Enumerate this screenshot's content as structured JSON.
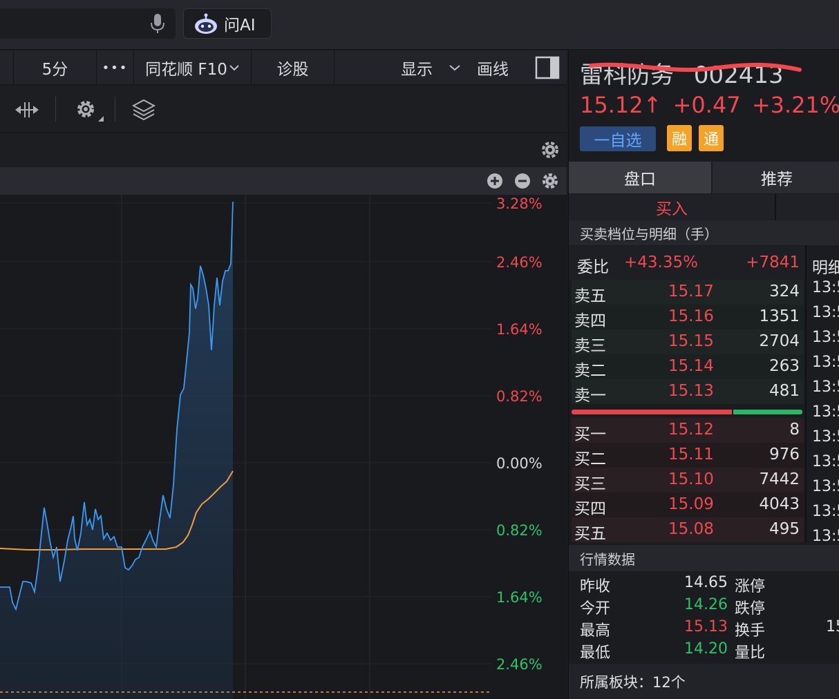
{
  "topbar": {
    "ai_label": "问AI"
  },
  "toolbar": {
    "period": "5分",
    "more": "•••",
    "f10": "同花顺 F10",
    "diagnose": "诊股",
    "display": "显示",
    "draw": "画线"
  },
  "chart": {
    "right_axis": [
      "3.28%",
      "2.46%",
      "1.64%",
      "0.82%",
      "0.00%",
      "0.82%",
      "1.64%",
      "2.46%"
    ],
    "right_axis_colors": [
      "#f0494f",
      "#f0494f",
      "#f0494f",
      "#f0494f",
      "#d6d7da",
      "#2cc26a",
      "#2cc26a",
      "#2cc26a"
    ],
    "price_line_color": "#3a9bf5",
    "avg_line_color": "#f29c38"
  },
  "stock": {
    "name": "雷科防务",
    "code": "002413",
    "price": "15.12↑",
    "change": "+0.47",
    "change_pct": "+3.21%",
    "fav_label": "一自选",
    "badge_margin": "融",
    "badge_connect": "通"
  },
  "tabs": {
    "tab1": "盘口",
    "tab2": "推荐"
  },
  "subtabs": {
    "buy": "买入"
  },
  "orderbook": {
    "title": "买卖档位与明细（手）",
    "ratio_label": "委比",
    "ratio_pct": "+43.35%",
    "ratio_diff": "+7841",
    "sell": [
      {
        "label": "卖五",
        "price": "15.17",
        "vol": "324"
      },
      {
        "label": "卖四",
        "price": "15.16",
        "vol": "1351"
      },
      {
        "label": "卖三",
        "price": "15.15",
        "vol": "2704"
      },
      {
        "label": "卖二",
        "price": "15.14",
        "vol": "263"
      },
      {
        "label": "卖一",
        "price": "15.13",
        "vol": "481"
      }
    ],
    "buy": [
      {
        "label": "买一",
        "price": "15.12",
        "vol": "8"
      },
      {
        "label": "买二",
        "price": "15.11",
        "vol": "976"
      },
      {
        "label": "买三",
        "price": "15.10",
        "vol": "7442"
      },
      {
        "label": "买四",
        "price": "15.09",
        "vol": "4043"
      },
      {
        "label": "买五",
        "price": "15.08",
        "vol": "495"
      }
    ],
    "buy_share": 0.7
  },
  "detail": {
    "header": "明细",
    "times": [
      "13:5",
      "13:5",
      "13:5",
      "13:5",
      "13:5",
      "13:5",
      "13:5",
      "13:5",
      "13:5",
      "13:5",
      "13:5"
    ]
  },
  "quote": {
    "title": "行情数据",
    "rows": [
      {
        "k": "昨收",
        "v": "14.65",
        "vc": "#e0e1e4",
        "k2": "涨停",
        "v2": ""
      },
      {
        "k": "今开",
        "v": "14.26",
        "vc": "#2cc26a",
        "k2": "跌停",
        "v2": ""
      },
      {
        "k": "最高",
        "v": "15.13",
        "vc": "#f0494f",
        "k2": "换手",
        "v2": "15"
      },
      {
        "k": "最低",
        "v": "14.20",
        "vc": "#2cc26a",
        "k2": "量比",
        "v2": ""
      }
    ],
    "sector": "所属板块：12个"
  }
}
